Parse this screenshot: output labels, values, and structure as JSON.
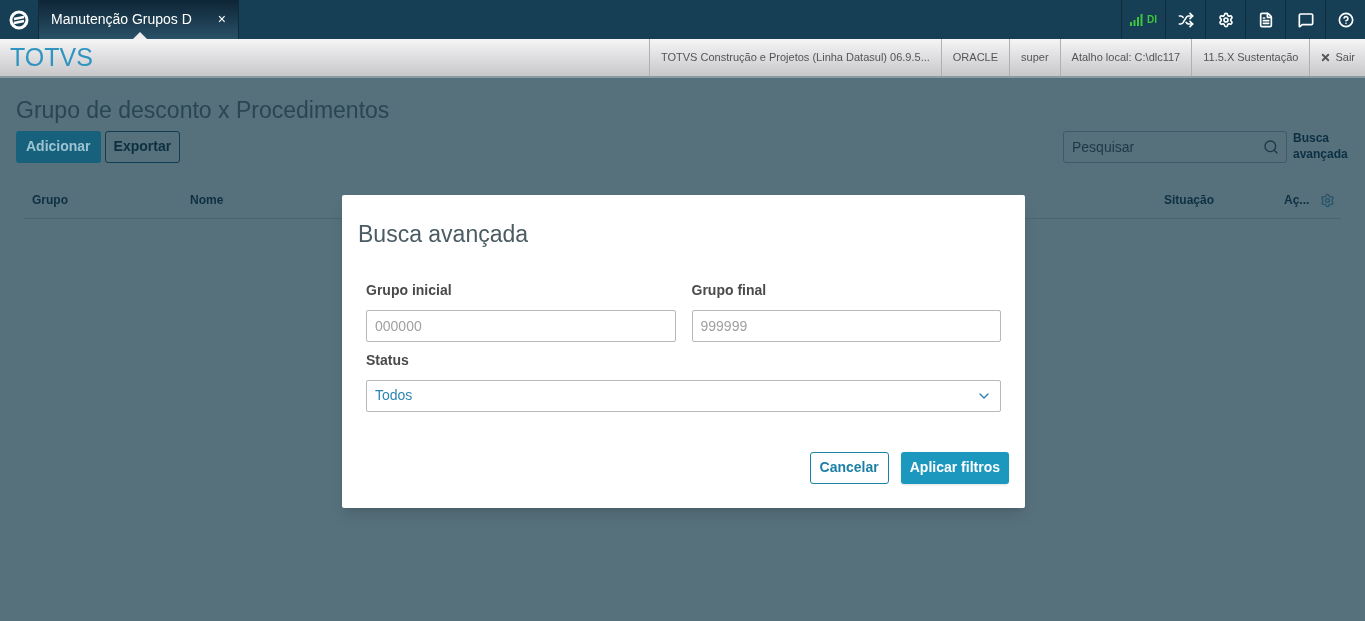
{
  "tab": {
    "title": "Manutenção Grupos D",
    "close": "×"
  },
  "network": {
    "label": "DI"
  },
  "brand": "TOTVS",
  "info_bar": [
    "TOTVS Construção e Projetos (Linha Datasul) 06.9.5...",
    "ORACLE",
    "super",
    "Atalho local: C:\\dlc117",
    "11.5.X Sustentação"
  ],
  "logout": "Sair",
  "page": {
    "title": "Grupo de desconto x Procedimentos",
    "buttons": [
      {
        "label": "Adicionar",
        "primary": true
      },
      {
        "label": "Exportar",
        "primary": false
      }
    ],
    "search": {
      "placeholder": "Pesquisar"
    },
    "advanced_link": "Busca avançada"
  },
  "table": {
    "columns": [
      "Grupo",
      "Nome",
      "Situação",
      "Aç..."
    ]
  },
  "dialog": {
    "title": "Busca avançada",
    "fields": [
      {
        "label": "Grupo inicial",
        "placeholder": "000000"
      },
      {
        "label": "Grupo final",
        "placeholder": "999999"
      }
    ],
    "status": {
      "label": "Status",
      "value": "Todos"
    },
    "buttons": [
      {
        "label": "Cancelar",
        "primary": false
      },
      {
        "label": "Aplicar filtros",
        "primary": true
      }
    ]
  }
}
